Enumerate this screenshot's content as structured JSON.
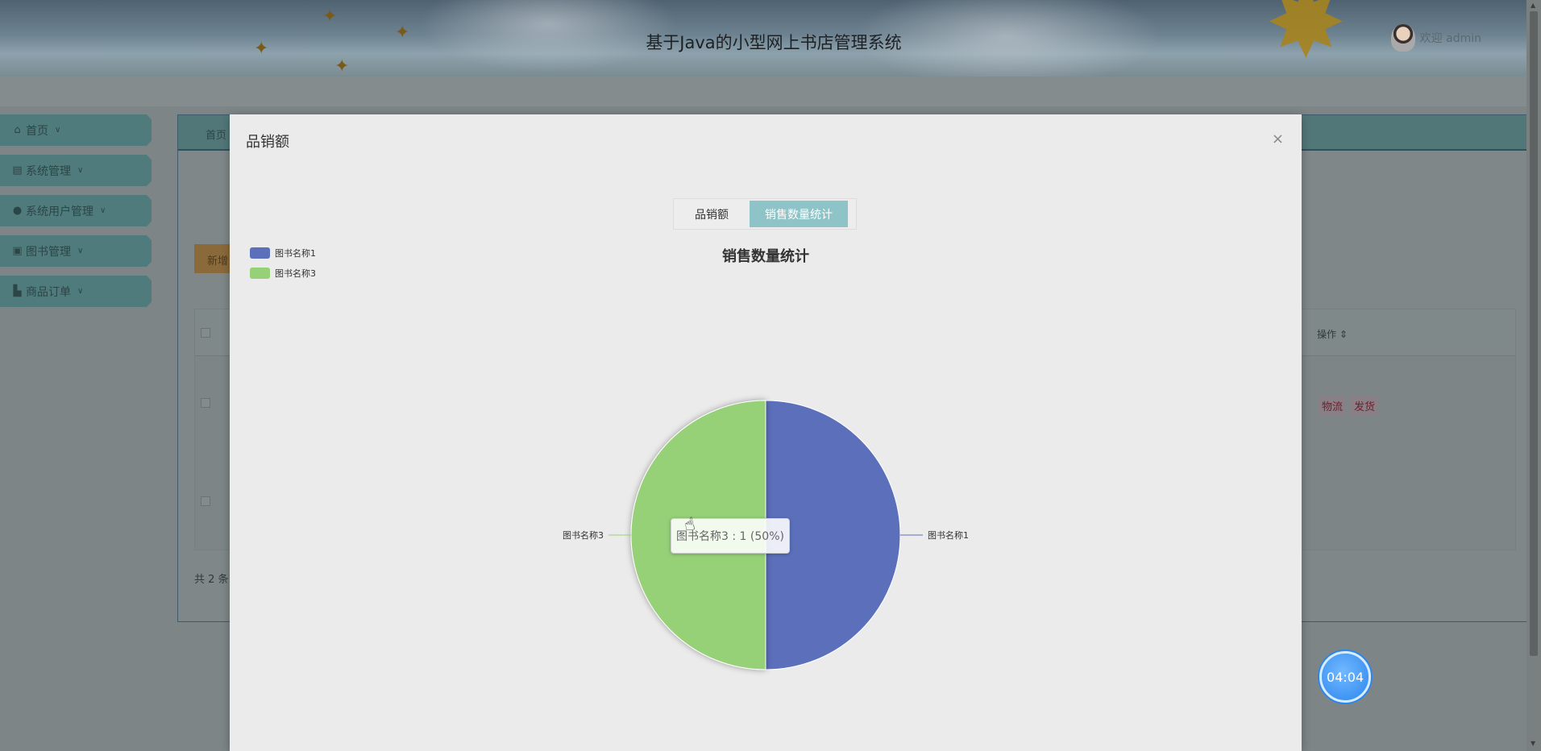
{
  "header": {
    "title": "基于Java的小型网上书店管理系统",
    "welcome": "欢迎 admin"
  },
  "sidebar": {
    "items": [
      {
        "label": "首页",
        "icon": "home-icon"
      },
      {
        "label": "系统管理",
        "icon": "server-icon"
      },
      {
        "label": "系统用户管理",
        "icon": "user-icon"
      },
      {
        "label": "图书管理",
        "icon": "briefcase-icon"
      },
      {
        "label": "商品订单",
        "icon": "building-icon"
      }
    ]
  },
  "page": {
    "tab_home": "首页",
    "add_button": "新增",
    "operation_header": "操作",
    "op_links": [
      "物流",
      "发货"
    ],
    "total_text": "共 2 条"
  },
  "modal": {
    "title": "品销额",
    "close": "×",
    "tabs": [
      {
        "label": "品销额",
        "active": false
      },
      {
        "label": "销售数量统计",
        "active": true
      }
    ],
    "tooltip": "图书名称3 : 1 (50%)"
  },
  "timer": "04:04",
  "chart_data": {
    "type": "pie",
    "title": "销售数量统计",
    "categories": [
      "图书名称1",
      "图书名称3"
    ],
    "values": [
      1,
      1
    ],
    "colors": [
      "#5b6fbb",
      "#96d077"
    ],
    "legend": "top-left"
  }
}
